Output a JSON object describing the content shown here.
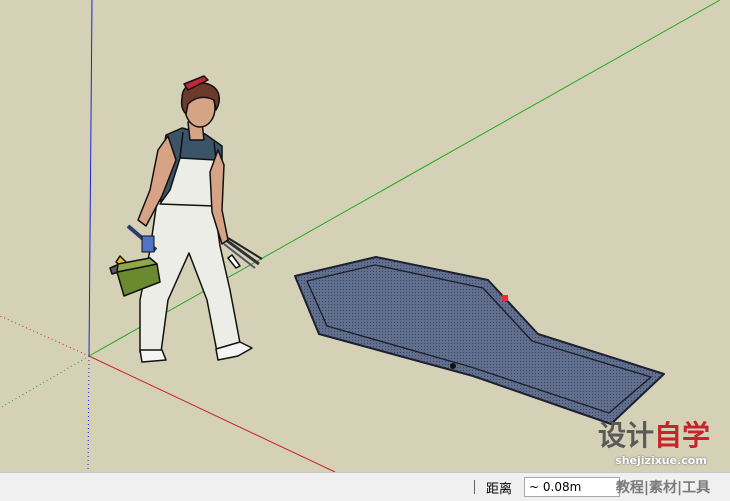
{
  "viewport": {
    "colors": {
      "background": "#d4d1b7",
      "red_axis": "#cc2222",
      "green_axis": "#22aa22",
      "blue_axis": "#2222cc",
      "shape_fill": "#5f6a8a",
      "shape_edge": "#1c2030",
      "endpoint_marker": "#e03030"
    },
    "figure": "scale figure: woman with toolbox and tools"
  },
  "statusbar": {
    "measure_label": "距离",
    "measure_value": "~ 0.08m"
  },
  "watermark": {
    "brand_gray": "设计",
    "brand_red": "自学",
    "url": "shejizixue.com",
    "tags": "教程|素材|工具"
  }
}
